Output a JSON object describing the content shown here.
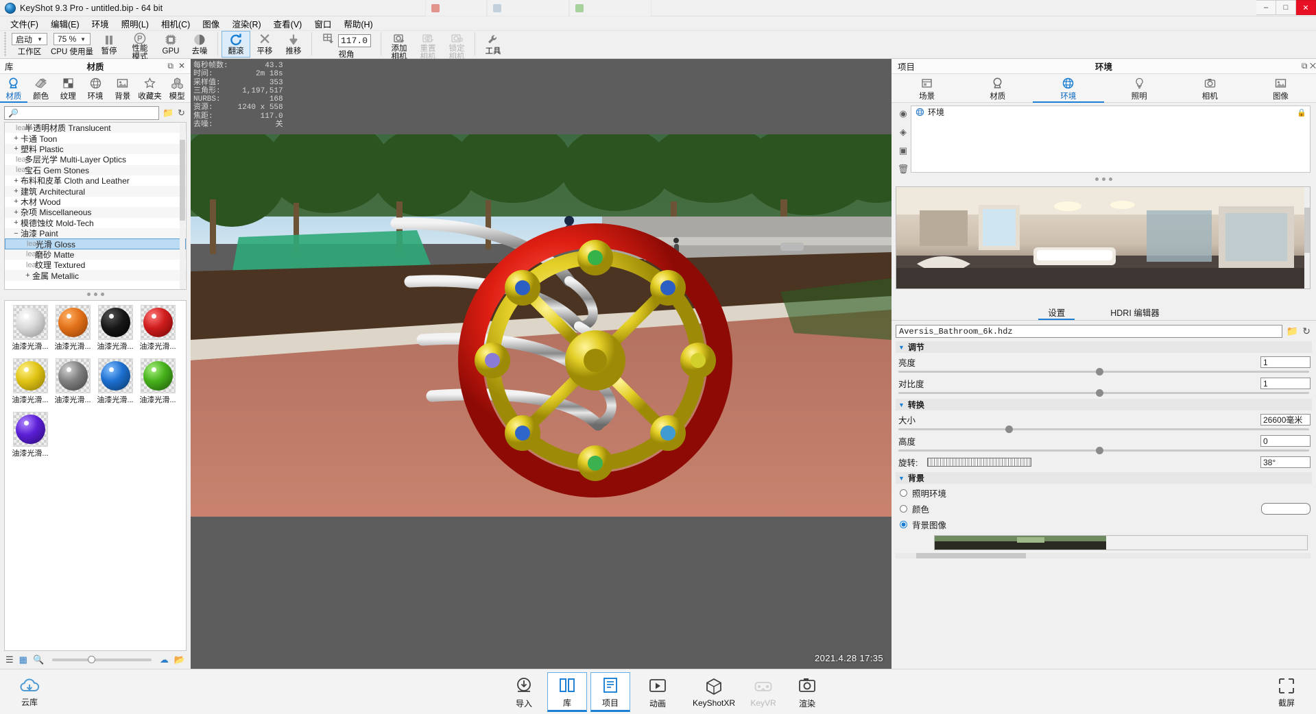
{
  "window": {
    "title": "KeyShot 9.3 Pro  - untitled.bip  - 64 bit",
    "minimize": "‒",
    "maximize": "□",
    "close": "✕",
    "ghost_tabs": [
      "",
      "",
      ""
    ]
  },
  "menubar": {
    "items": [
      {
        "label": "文件(F)"
      },
      {
        "label": "编辑(E)"
      },
      {
        "label": "环境"
      },
      {
        "label": "照明(L)"
      },
      {
        "label": "相机(C)"
      },
      {
        "label": "图像"
      },
      {
        "label": "渲染(R)"
      },
      {
        "label": "查看(V)"
      },
      {
        "label": "窗口"
      },
      {
        "label": "帮助(H)"
      }
    ]
  },
  "toolbar": {
    "workspace": {
      "value": "启动",
      "label": "工作区"
    },
    "cpu": {
      "value": "75 %",
      "label": "CPU 使用量"
    },
    "pause": {
      "label": "暂停",
      "icon": "pause-icon"
    },
    "performance": {
      "label": "性能\n模式",
      "label_line1": "性能",
      "label_line2": "模式",
      "icon": "performance-icon"
    },
    "gpu": {
      "label": "GPU",
      "icon": "gpu-chip-icon"
    },
    "denoise": {
      "label": "去噪",
      "icon": "denoise-icon"
    },
    "tumble": {
      "label": "翻滚",
      "icon": "tumble-icon",
      "active": true
    },
    "pan": {
      "label": "平移",
      "icon": "pan-icon"
    },
    "dolly": {
      "label": "推移",
      "icon": "dolly-icon"
    },
    "view": {
      "label": "视角",
      "value": "117.0",
      "icon": "grid-view-icon"
    },
    "add_camera": {
      "label": "添加\n相机",
      "label_line1": "添加",
      "label_line2": "相机",
      "icon": "add-camera-icon"
    },
    "reset_camera": {
      "label_line1": "重置",
      "label_line2": "相机",
      "icon": "reset-camera-icon",
      "disabled": true
    },
    "lock_camera": {
      "label_line1": "锁定",
      "label_line2": "相机",
      "icon": "lock-camera-icon",
      "disabled": true
    },
    "tools": {
      "label": "工具",
      "icon": "tools-icon"
    }
  },
  "library": {
    "header_left": "库",
    "header_center": "材质",
    "header_buttons": [
      "⧉",
      "✕"
    ],
    "tabs": [
      {
        "label": "材质",
        "icon": "material-icon",
        "selected": true
      },
      {
        "label": "颜色",
        "icon": "color-icon",
        "selected": false
      },
      {
        "label": "纹理",
        "icon": "texture-icon",
        "selected": false
      },
      {
        "label": "环境",
        "icon": "environment-globe-icon",
        "selected": false
      },
      {
        "label": "背景",
        "icon": "background-image-icon",
        "selected": false
      },
      {
        "label": "收藏夹",
        "icon": "star-icon",
        "selected": false
      },
      {
        "label": "模型",
        "icon": "model-cubes-icon",
        "selected": false
      }
    ],
    "search": {
      "value": "",
      "placeholder": ""
    },
    "search_buttons": [
      "folder-icon",
      "refresh-icon"
    ],
    "tree": [
      {
        "label": "半透明材质 Translucent",
        "expander": "leaf",
        "indent": 1,
        "selected": false
      },
      {
        "label": "卡通 Toon",
        "expander": "+",
        "indent": 0,
        "selected": false
      },
      {
        "label": "塑料 Plastic",
        "expander": "+",
        "indent": 0,
        "selected": false
      },
      {
        "label": "多层光学 Multi-Layer Optics",
        "expander": "leaf",
        "indent": 1,
        "selected": false
      },
      {
        "label": "宝石 Gem Stones",
        "expander": "leaf",
        "indent": 1,
        "selected": false
      },
      {
        "label": "布料和皮革 Cloth and Leather",
        "expander": "+",
        "indent": 0,
        "selected": false
      },
      {
        "label": "建筑 Architectural",
        "expander": "+",
        "indent": 0,
        "selected": false
      },
      {
        "label": "木材 Wood",
        "expander": "+",
        "indent": 0,
        "selected": false
      },
      {
        "label": "杂项 Miscellaneous",
        "expander": "+",
        "indent": 0,
        "selected": false
      },
      {
        "label": "模德蚀纹 Mold-Tech",
        "expander": "+",
        "indent": 0,
        "selected": false
      },
      {
        "label": "油漆 Paint",
        "expander": "−",
        "indent": 0,
        "selected": false
      },
      {
        "label": "光滑 Gloss",
        "expander": "leaf",
        "indent": 2,
        "selected": true
      },
      {
        "label": "磨砂 Matte",
        "expander": "leaf",
        "indent": 2,
        "selected": false
      },
      {
        "label": "纹理 Textured",
        "expander": "leaf",
        "indent": 2,
        "selected": false
      },
      {
        "label": "金属 Metallic",
        "expander": "+",
        "indent": 1,
        "selected": false
      }
    ],
    "materials": [
      {
        "label": "油漆光滑...",
        "color": "#d9d9d9"
      },
      {
        "label": "油漆光滑...",
        "color": "#e2721a"
      },
      {
        "label": "油漆光滑...",
        "color": "#171717"
      },
      {
        "label": "油漆光滑...",
        "color": "#cf1d1d"
      },
      {
        "label": "油漆光滑...",
        "color": "#e0c415"
      },
      {
        "label": "油漆光滑...",
        "color": "#818181"
      },
      {
        "label": "油漆光滑...",
        "color": "#1d6fd0"
      },
      {
        "label": "油漆光滑...",
        "color": "#46b11b"
      },
      {
        "label": "油漆光滑...",
        "color": "#5b1fd6"
      }
    ],
    "footer_icons": [
      "list-view-icon",
      "grid-view-icon",
      "zoom-icon",
      "cloud-download-icon",
      "folder-open-icon"
    ],
    "zoom_value": "52"
  },
  "viewport": {
    "stats": [
      {
        "key": "每秒帧数:",
        "value": "43.3"
      },
      {
        "key": "时间:",
        "value": "2m 18s"
      },
      {
        "key": "采样值:",
        "value": "353"
      },
      {
        "key": "三角形:",
        "value": "1,197,517"
      },
      {
        "key": "NURBS:",
        "value": "168"
      },
      {
        "key": "资源:",
        "value": "1240 x 558"
      },
      {
        "key": "焦距:",
        "value": "117.0"
      },
      {
        "key": "去噪:",
        "value": "关"
      }
    ],
    "stamp": "2021.4.28 17:35"
  },
  "project": {
    "header_left": "项目",
    "header_center": "环境",
    "header_buttons": [
      "⧉",
      "✕"
    ],
    "tabs": [
      {
        "label": "场景",
        "icon": "scene-icon",
        "selected": false
      },
      {
        "label": "材质",
        "icon": "material-icon",
        "selected": false
      },
      {
        "label": "环境",
        "icon": "environment-globe-icon",
        "selected": true
      },
      {
        "label": "照明",
        "icon": "lighting-icon",
        "selected": false
      },
      {
        "label": "相机",
        "icon": "camera-icon",
        "selected": false
      },
      {
        "label": "图像",
        "icon": "image-icon",
        "selected": false
      }
    ],
    "side_tools": [
      "add-environment-icon",
      "duplicate-environment-icon",
      "import-environment-icon",
      "delete-icon"
    ],
    "env_list": [
      {
        "label": "环境",
        "icon": "environment-globe-icon"
      }
    ],
    "lock_icon": "lock-icon",
    "settings_tabs": [
      {
        "label": "设置",
        "selected": true
      },
      {
        "label": "HDRI 编辑器",
        "selected": false
      }
    ],
    "hdri_file": "Aversis_Bathroom_6k.hdz",
    "hdri_buttons": [
      "folder-icon",
      "refresh-icon"
    ],
    "sections": {
      "adjust": {
        "title": "调节",
        "rows": [
          {
            "label": "亮度",
            "value": "1",
            "slider_pct": 50
          },
          {
            "label": "对比度",
            "value": "1",
            "slider_pct": 50
          }
        ]
      },
      "transform": {
        "title": "转换",
        "rows": [
          {
            "label": "大小",
            "value": "26600毫米",
            "slider_pct": 28
          },
          {
            "label": "高度",
            "value": "0",
            "slider_pct": 50
          }
        ],
        "rotation": {
          "label": "旋转:",
          "value": "38°"
        }
      },
      "background": {
        "title": "背景",
        "options": [
          {
            "label": "照明环境",
            "selected": false
          },
          {
            "label": "颜色",
            "selected": false,
            "swatch": "#ffffff"
          },
          {
            "label": "背景图像",
            "selected": true
          }
        ]
      }
    }
  },
  "bottombar": {
    "cloud": {
      "label": "云库",
      "icon": "cloud-icon"
    },
    "buttons": [
      {
        "label": "导入",
        "icon": "import-icon",
        "selected": false,
        "disabled": false
      },
      {
        "label": "库",
        "icon": "library-book-icon",
        "selected": true,
        "disabled": false
      },
      {
        "label": "项目",
        "icon": "project-icon",
        "selected": true,
        "disabled": false
      },
      {
        "label": "动画",
        "icon": "animation-play-icon",
        "selected": false,
        "disabled": false
      },
      {
        "label": "KeyShotXR",
        "icon": "keyshotxr-icon",
        "selected": false,
        "disabled": false
      },
      {
        "label": "KeyVR",
        "icon": "keyvr-icon",
        "selected": false,
        "disabled": true
      },
      {
        "label": "渲染",
        "icon": "render-icon",
        "selected": false,
        "disabled": false
      }
    ],
    "crop": {
      "label": "截屏",
      "icon": "crop-icon"
    }
  },
  "colors": {
    "accent": "#1a7fd4",
    "selection": "#bcdcf5",
    "panel_bg": "#f0f0f0",
    "viewport_bg": "#5d5d5d",
    "close_red": "#e81123"
  }
}
